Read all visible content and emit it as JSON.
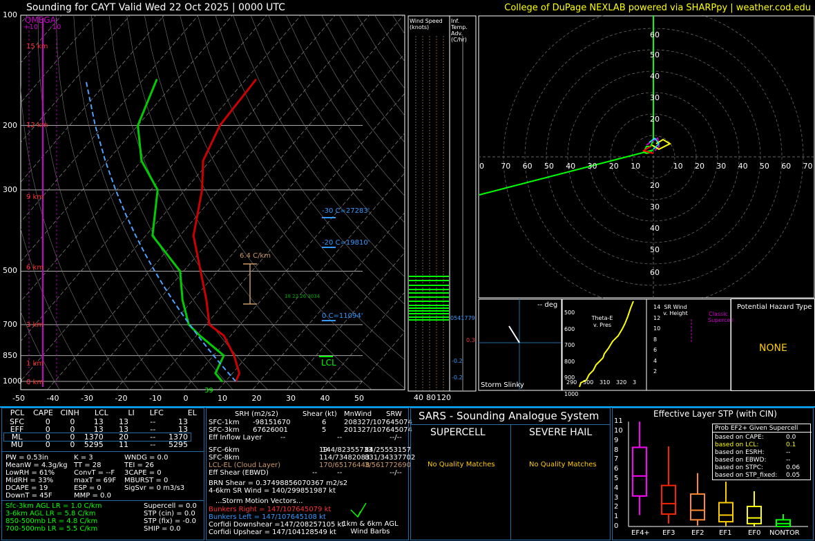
{
  "header": {
    "title": "Sounding for CAYT Valid  Wed 22 Oct 2025 | 0000 UTC",
    "credit": "College of DuPage NEXLAB powered via SHARPpy | weather.cod.edu"
  },
  "skewt": {
    "omega_label": "OMEGA",
    "omega_ticks": [
      "+10",
      "-10"
    ],
    "pressure_ticks": [
      "100",
      "200",
      "300",
      "500",
      "700",
      "850",
      "1000"
    ],
    "temp_ticks": [
      "-50",
      "-40",
      "-30",
      "-20",
      "-10",
      "0",
      "10",
      "20",
      "30",
      "40",
      "50"
    ],
    "height_ticks": [
      "15 km",
      "12 km",
      "9 km",
      "6 km",
      "3 km",
      "1 km",
      "0 km"
    ],
    "annotations": {
      "lapse": "6.4 C/km",
      "wbz": "-20 C=19810'",
      "frz": "-30 C=27283'",
      "zero": "0 C=11094'",
      "lcl": "LCL",
      "sfc_temp": "39",
      "hgt_small": "18 22 26 3034"
    }
  },
  "wind_col": {
    "title": "Wind Speed (knots)",
    "ticks": [
      "40",
      "80",
      "120"
    ]
  },
  "adv_col": {
    "title": "Inf. Temp. Adv. (C/hr)",
    "vals": [
      "0.3",
      "-0.2",
      "-0.2"
    ],
    "side": "0541779"
  },
  "hodo": {
    "y_ticks": [
      "60",
      "50",
      "40",
      "30",
      "20",
      "10",
      "10",
      "20",
      "30",
      "40",
      "50",
      "60"
    ],
    "x_ticks": [
      "0",
      "70",
      "60",
      "50",
      "40",
      "30",
      "20",
      "10",
      "",
      "10",
      "20",
      "30",
      "40",
      "50",
      "60",
      "70"
    ]
  },
  "slinky": {
    "deg": "-- deg",
    "label": "Storm Slinky"
  },
  "thetae": {
    "title": "Theta-E v. Pres",
    "y_ticks": [
      "500",
      "600",
      "700",
      "800",
      "900",
      "1000"
    ],
    "x_ticks": [
      "290",
      "300",
      "310",
      "320",
      "3"
    ]
  },
  "srwind": {
    "title": "SR Wind v. Height",
    "y_ticks": [
      "14",
      "12",
      "10",
      "8",
      "6",
      "4",
      "2"
    ],
    "classic": "Classic Supercell"
  },
  "hazard": {
    "title": "Potential Hazard Type",
    "value": "NONE"
  },
  "parcels": {
    "headers": [
      "PCL",
      "CAPE",
      "CINH",
      "LCL",
      "LI",
      "LFC",
      "EL"
    ],
    "rows": [
      [
        "SFC",
        "0",
        "0",
        "13",
        "13",
        "--",
        "13"
      ],
      [
        "EFF",
        "0",
        "0",
        "13",
        "13",
        "--",
        "13"
      ],
      [
        "ML",
        "0",
        "0",
        "1370",
        "20",
        "--",
        "1370"
      ],
      [
        "MU",
        "0",
        "0",
        "5295",
        "11",
        "--",
        "5295"
      ]
    ]
  },
  "indices": {
    "col1": [
      "PW = 0.53in",
      "MeanW = 4.3g/kg",
      "LowRH = 61%",
      "MidRH = 33%",
      "DCAPE = 19",
      "DownT = 45F"
    ],
    "col2": [
      "K = 3",
      "TT = 28",
      "ConvT = --F",
      "maxT = 69F",
      "ESP = 0",
      "MMP = 0.0"
    ],
    "col3": [
      "WNDG = 0.0",
      "TEI = 26",
      "3CAPE = 0",
      "MBURST = 0",
      "",
      "SigSvr = 0 m3/s3"
    ]
  },
  "lapse": {
    "left": [
      "Sfc-3km AGL LR = 1.0 C/km",
      "3-6km AGL LR = 5.8 C/km",
      "850-500mb LR = 4.8 C/km",
      "700-500mb LR = 5.5 C/km"
    ],
    "right": [
      "Supercell = 0.0",
      "STP (cin) = 0.0",
      "STP (fix) = -0.0",
      "SHIP = 0.0"
    ]
  },
  "kinematics": {
    "headers": [
      "SRH (m2/s2)",
      "Shear (kt)",
      "MnWind",
      "SRW"
    ],
    "rows": [
      [
        "SFC-1km",
        "-98151670",
        "6",
        "208327/107645074"
      ],
      [
        "SFC-3km",
        "67626001",
        "5",
        "201327/107645074"
      ],
      [
        "Eff Inflow Layer",
        "--",
        "--",
        "--/--"
      ],
      [
        "SFC-6km",
        "19",
        "144/82355733",
        "84/25553157"
      ],
      [
        "SFC-8km",
        "114/73482083",
        "",
        "831/34337702"
      ],
      [
        "LCL-EL (Cloud Layer)",
        "170/65176448",
        "",
        "3/561772690"
      ],
      [
        "Eff Shear (EBWD)",
        "--",
        "--",
        "--/--"
      ]
    ],
    "brn": "BRN Shear = 0.37498856070367 m2/s2",
    "sr46": "4-6km SR Wind = 140/299851987 kt",
    "storm_motion": "...Storm Motion Vectors...",
    "bunkers_right": "Bunkers Right =   147/107645079 kt",
    "bunkers_left": "Bunkers Left =    147/107645108 kt",
    "corfidi_down": "Corfidi Downshear =147/208257105 kt",
    "corfidi_up": "Corfidi Upshear = 147/104128549 kt",
    "barbs_label": "1km & 6km AGL Wind Barbs"
  },
  "sars": {
    "title": "SARS - Sounding Analogue System",
    "supercell": "SUPERCELL",
    "hail": "SEVERE HAIL",
    "sup_match": "No Quality Matches",
    "hail_match": "No Quality Matches"
  },
  "stp": {
    "title": "Effective Layer STP (with CIN)",
    "y_ticks": [
      "11",
      "10",
      "9",
      "8",
      "7",
      "6",
      "5",
      "4",
      "3",
      "2",
      "1",
      "0"
    ],
    "x_ticks": [
      "EF4+",
      "EF3",
      "EF2",
      "EF1",
      "EF0",
      "NONTOR"
    ],
    "prob_title": "Prob EF2+ Given Supercell",
    "prob_rows": [
      [
        "based on CAPE:",
        "0.0"
      ],
      [
        "based on LCL:",
        "0.1"
      ],
      [
        "based on ESRH:",
        "--"
      ],
      [
        "based on EBWD:",
        "--"
      ],
      [
        "based on STPC:",
        "0.06"
      ],
      [
        "based on STP_fixed:",
        "0.05"
      ]
    ]
  },
  "colors": {
    "temp": "#cc0000",
    "dewpoint": "#00cc00",
    "parcel": "#ffffff",
    "omega": "#cc00cc",
    "hodo_line": "#00ff00",
    "accent": "#00aaff"
  },
  "chart_data": {
    "type": "line",
    "title": "Sounding for CAYT Valid  Wed 22 Oct 2025 | 0000 UTC",
    "xlabel": "",
    "ylabel": "",
    "xlim": [
      -50,
      50
    ],
    "ylim": [
      1000,
      100
    ],
    "series": [
      {
        "name": "",
        "x": [
          13,
          12,
          6,
          -2,
          -9,
          -16,
          -25,
          -36,
          -45,
          -52,
          -56,
          -57
        ],
        "y": [
          1000,
          950,
          850,
          750,
          700,
          600,
          500,
          400,
          300,
          250,
          200,
          150
        ]
      },
      {
        "name": "",
        "x": [
          9,
          5,
          3,
          -9,
          -15,
          -23,
          -31,
          -48,
          -58,
          -70,
          -80,
          -86
        ],
        "y": [
          1000,
          950,
          850,
          750,
          700,
          600,
          500,
          400,
          300,
          250,
          200,
          150
        ]
      }
    ]
  }
}
